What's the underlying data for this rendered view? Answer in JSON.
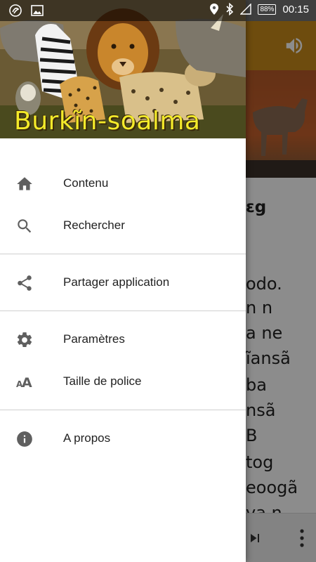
{
  "status_bar": {
    "battery": "88%",
    "time": "00:15"
  },
  "drawer": {
    "header_title": "Burkĩn-soalma",
    "items": [
      {
        "label": "Contenu",
        "icon": "home-icon"
      },
      {
        "label": "Rechercher",
        "icon": "search-icon"
      },
      {
        "label": "Partager application",
        "icon": "share-icon"
      },
      {
        "label": "Paramètres",
        "icon": "gear-icon"
      },
      {
        "label": "Taille de police",
        "icon": "font-size-icon"
      },
      {
        "label": "A propos",
        "icon": "info-icon"
      }
    ]
  },
  "background": {
    "title_fragment": "ɛg",
    "text_lines": [
      "odo.",
      "n n",
      "a ne",
      "ĩansã",
      "ba",
      "nsã",
      "B",
      "tog",
      "eoogã",
      "va n"
    ]
  },
  "colors": {
    "toolbar": "#c98a1a",
    "header_text": "#f3ea2a",
    "icon": "#5f5f5f"
  }
}
